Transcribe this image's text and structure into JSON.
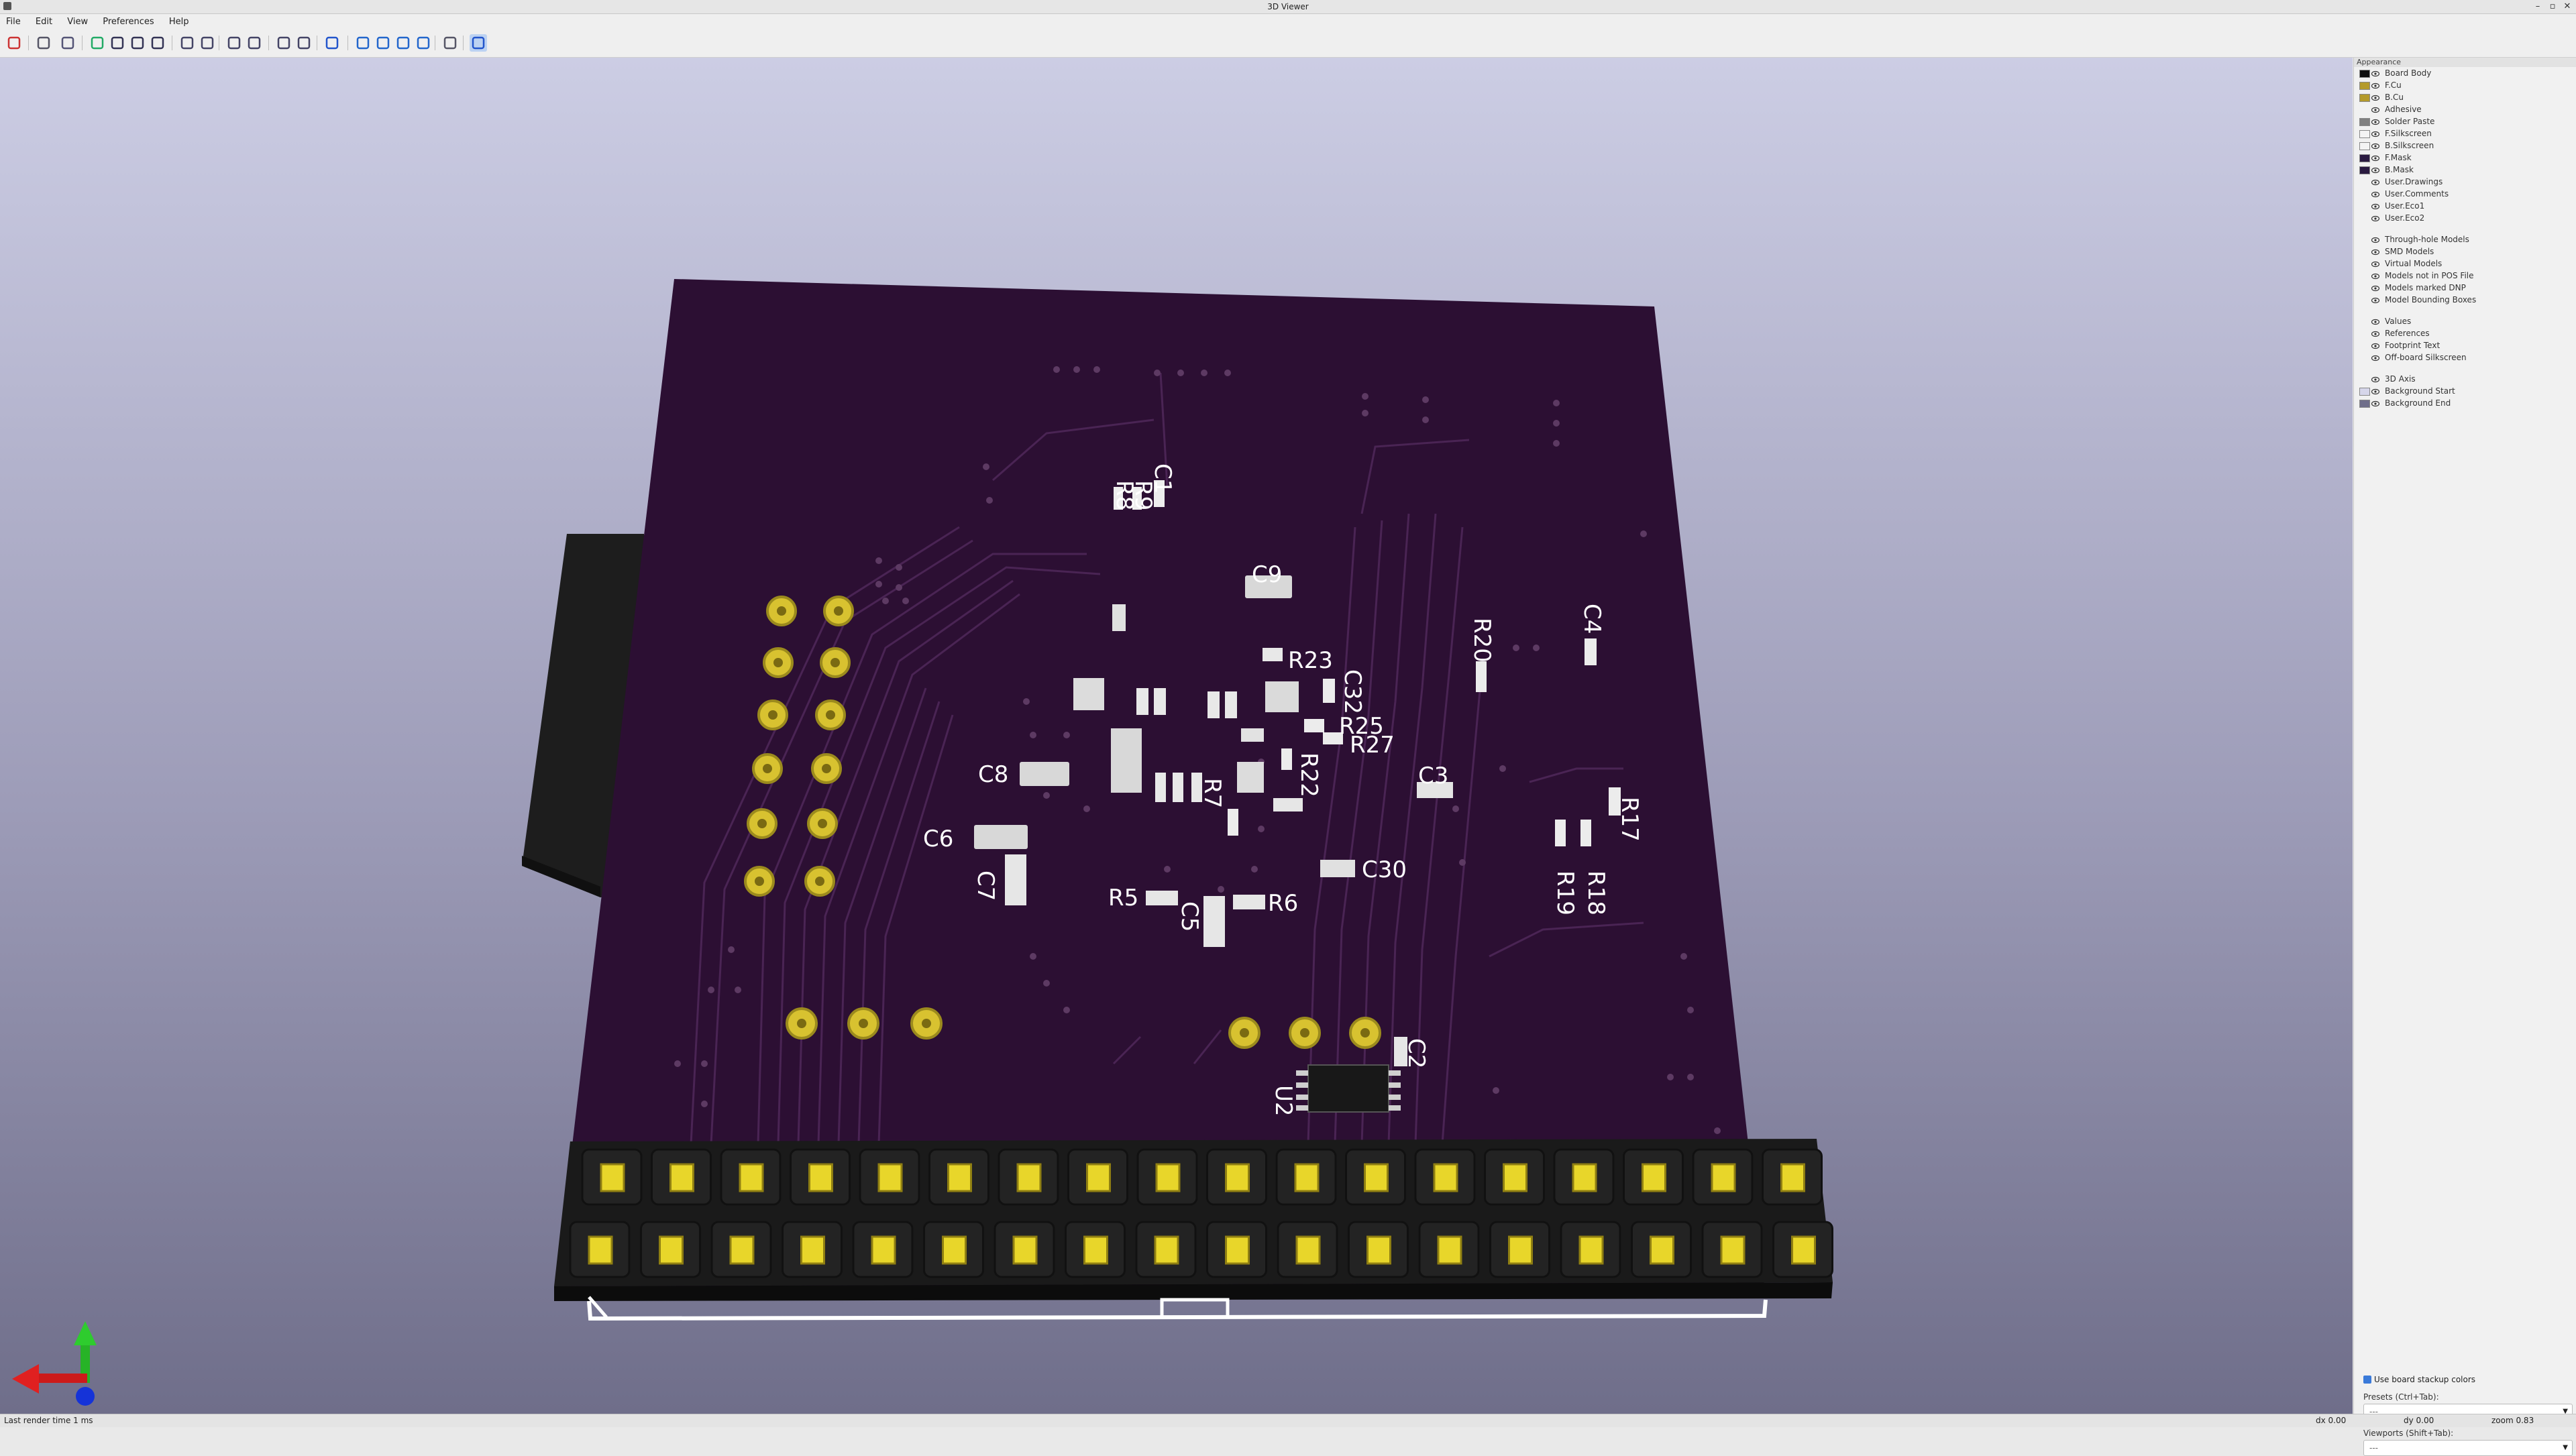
{
  "window": {
    "title": "3D Viewer"
  },
  "menu": [
    "File",
    "Edit",
    "View",
    "Preferences",
    "Help"
  ],
  "toolbar_icons": [
    "render-raytracing-icon",
    "copy-image-icon",
    "zoom-redraw-icon",
    "reload-icon",
    "zoom-in-icon",
    "zoom-out-icon",
    "zoom-fit-icon",
    "rotate-x-ccw-icon",
    "rotate-x-cw-icon",
    "rotate-y-ccw-icon",
    "rotate-y-cw-icon",
    "rotate-z-ccw-icon",
    "rotate-z-cw-icon",
    "flip-board-icon",
    "pan-left-icon",
    "pan-right-icon",
    "pan-up-icon",
    "pan-down-icon",
    "orthographic-icon",
    "layers-manager-icon"
  ],
  "appearance": {
    "header": "Appearance",
    "layers": [
      {
        "name": "Board Body",
        "color": "#101010"
      },
      {
        "name": "F.Cu",
        "color": "#b49a2a"
      },
      {
        "name": "B.Cu",
        "color": "#b49a2a"
      },
      {
        "name": "Adhesive",
        "color": ""
      },
      {
        "name": "Solder Paste",
        "color": "#808080"
      },
      {
        "name": "F.Silkscreen",
        "color": "#f4f4f4"
      },
      {
        "name": "B.Silkscreen",
        "color": "#f4f4f4"
      },
      {
        "name": "F.Mask",
        "color": "#2a1a40"
      },
      {
        "name": "B.Mask",
        "color": "#2a1a40"
      },
      {
        "name": "User.Drawings",
        "color": ""
      },
      {
        "name": "User.Comments",
        "color": ""
      },
      {
        "name": "User.Eco1",
        "color": ""
      },
      {
        "name": "User.Eco2",
        "color": ""
      }
    ],
    "models": [
      "Through-hole Models",
      "SMD Models",
      "Virtual Models",
      "Models not in POS File",
      "Models marked DNP",
      "Model Bounding Boxes"
    ],
    "text_items": [
      "Values",
      "References",
      "Footprint Text",
      "Off-board Silkscreen"
    ],
    "misc": [
      {
        "name": "3D Axis",
        "color": ""
      },
      {
        "name": "Background Start",
        "color": "#d6d6ea"
      },
      {
        "name": "Background End",
        "color": "#6f6e8a"
      }
    ],
    "use_stackup_label": "Use board stackup colors",
    "presets_label": "Presets (Ctrl+Tab):",
    "presets_value": "---",
    "viewports_label": "Viewports (Shift+Tab):",
    "viewports_value": "---"
  },
  "board": {
    "references": [
      "R8",
      "R9",
      "C1",
      "C9",
      "R23",
      "C32",
      "R25",
      "R27",
      "R22",
      "R20",
      "C4",
      "C3",
      "R17",
      "R18",
      "R19",
      "C8",
      "R7",
      "C6",
      "C7",
      "C30",
      "R5",
      "R6",
      "C5",
      "C2",
      "U2"
    ]
  },
  "status": {
    "render_time": "Last render time 1 ms",
    "dx": "dx 0.00",
    "dy": "dy 0.00",
    "zoom": "zoom 0.83"
  }
}
